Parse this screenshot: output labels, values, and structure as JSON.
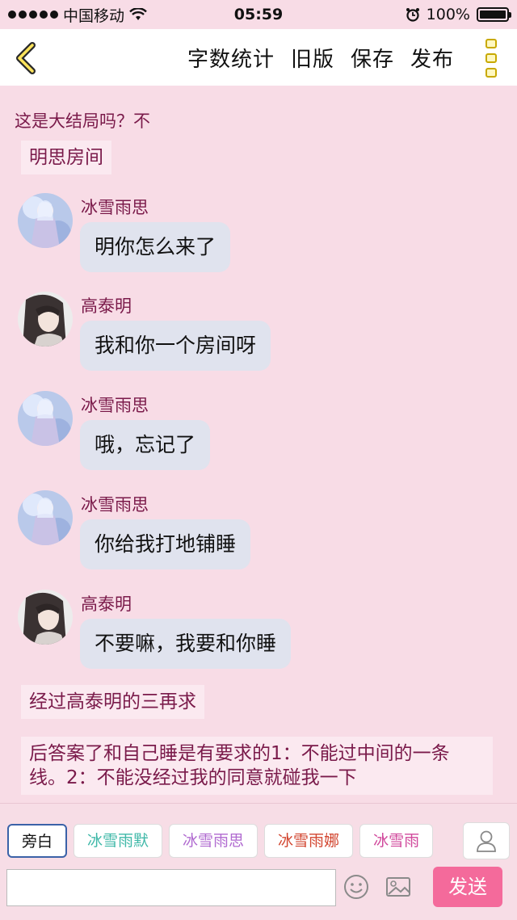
{
  "status_bar": {
    "carrier": "中国移动",
    "time": "05:59",
    "battery": "100%",
    "battery_level": 1.0
  },
  "nav": {
    "back_icon": "chevron-left-icon",
    "actions": [
      "字数统计",
      "旧版",
      "保存",
      "发布"
    ],
    "more_icon": "more-icon"
  },
  "content": {
    "intro": "这是大结局吗？不",
    "scene": "明思房间",
    "messages": [
      {
        "speaker": "冰雪雨思",
        "avatar": "avatar-bingxue-yusi",
        "text": "明你怎么来了"
      },
      {
        "speaker": "高泰明",
        "avatar": "avatar-gao-taiming",
        "text": "我和你一个房间呀"
      },
      {
        "speaker": "冰雪雨思",
        "avatar": "avatar-bingxue-yusi",
        "text": "哦，忘记了"
      },
      {
        "speaker": "冰雪雨思",
        "avatar": "avatar-bingxue-yusi",
        "text": "你给我打地铺睡"
      },
      {
        "speaker": "高泰明",
        "avatar": "avatar-gao-taiming",
        "text": "不要嘛，我要和你睡"
      }
    ],
    "narration_1": "经过高泰明的三再求",
    "narration_2": "后答案了和自己睡是有要求的1：不能过中间的一条线。2：不能没经过我的同意就碰我一下"
  },
  "toolbar": {
    "roles": [
      {
        "label": "旁白",
        "color": "#111111"
      },
      {
        "label": "冰雪雨默",
        "color": "#3fb8a8"
      },
      {
        "label": "冰雪雨思",
        "color": "#b06ad0"
      },
      {
        "label": "冰雪雨娜",
        "color": "#d2452f"
      },
      {
        "label": "冰雪雨",
        "color": "#d0479b"
      }
    ],
    "input_placeholder": "",
    "send_label": "发送"
  }
}
